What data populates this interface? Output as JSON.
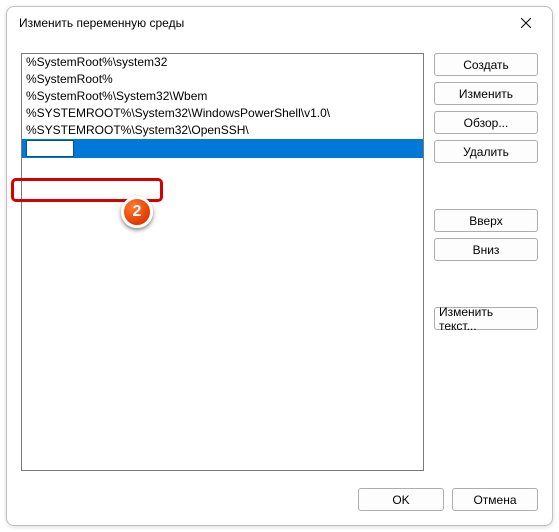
{
  "title": "Изменить переменную среды",
  "list": {
    "items": [
      "%SystemRoot%\\system32",
      "%SystemRoot%",
      "%SystemRoot%\\System32\\Wbem",
      "%SYSTEMROOT%\\System32\\WindowsPowerShell\\v1.0\\",
      "%SYSTEMROOT%\\System32\\OpenSSH\\"
    ],
    "editing_value": ""
  },
  "buttons": {
    "create": "Создать",
    "edit": "Изменить",
    "browse": "Обзор...",
    "delete": "Удалить",
    "up": "Вверх",
    "down": "Вниз",
    "edit_text": "Изменить текст..."
  },
  "footer": {
    "ok": "OK",
    "cancel": "Отмена"
  },
  "annotation": {
    "badge": "2"
  }
}
